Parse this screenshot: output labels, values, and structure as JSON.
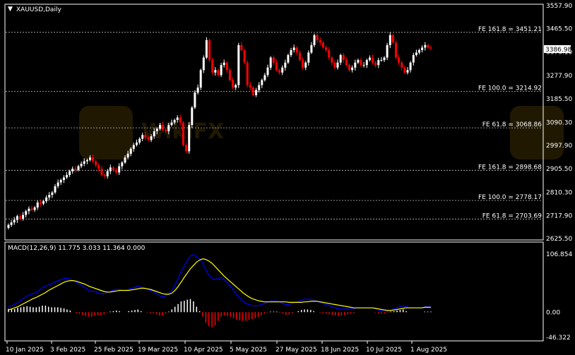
{
  "window": {
    "symbol_label": "XAUUSD,Daily",
    "current_price_label": "3386.98",
    "macd_label": "MACD(12,26,9) 11.775 3.033 11.364 0.000"
  },
  "colors": {
    "background": "#000000",
    "frame": "#ffffff",
    "bull_candle": "#ffffff",
    "bear_candle": "#ff0000",
    "fib_lines": "#c0c0c0",
    "macd_line": "#0000ff",
    "signal_line": "#ffff00",
    "hist_positive": "#ffffff",
    "hist_negative": "#ff0000"
  },
  "chart_data": [
    {
      "type": "candlestick",
      "title": "XAUUSD,Daily",
      "ylim": [
        2625.5,
        3557.9
      ],
      "y_ticks": [
        "3557.90",
        "3465.50",
        "3373.10",
        "3277.90",
        "3185.50",
        "3090.30",
        "2997.90",
        "2905.50",
        "2810.30",
        "2717.90",
        "2625.50"
      ],
      "x_ticks": [
        "10 Jan 2025",
        "3 Feb 2025",
        "25 Feb 2025",
        "19 Mar 2025",
        "10 Apr 2025",
        "5 May 2025",
        "27 May 2025",
        "18 Jun 2025",
        "10 Jul 2025",
        "1 Aug 2025"
      ],
      "levels": [
        {
          "label": "FE 161.8 = 3451.21",
          "value": 3451.21
        },
        {
          "label": "FE 100.0 = 3214.92",
          "value": 3214.92
        },
        {
          "label": "FE 61.8 = 3068.86",
          "value": 3068.86
        },
        {
          "label": "FE 161.8 = 2898.68",
          "value": 2898.68
        },
        {
          "label": "FE 100.0 = 2778.17",
          "value": 2778.17
        },
        {
          "label": "FE 61.8 = 2703.69",
          "value": 2703.69
        }
      ],
      "last_price": 3386.98,
      "close_approx": [
        2680,
        2690,
        2700,
        2715,
        2705,
        2720,
        2735,
        2745,
        2740,
        2750,
        2770,
        2765,
        2775,
        2790,
        2800,
        2810,
        2835,
        2850,
        2860,
        2870,
        2880,
        2895,
        2905,
        2900,
        2915,
        2925,
        2935,
        2940,
        2950,
        2935,
        2920,
        2905,
        2880,
        2875,
        2895,
        2910,
        2900,
        2890,
        2915,
        2930,
        2950,
        2965,
        2985,
        3000,
        3010,
        3025,
        3040,
        3030,
        3020,
        3035,
        3055,
        3065,
        3080,
        3060,
        3055,
        3080,
        3090,
        3100,
        3110,
        3090,
        3000,
        2975,
        3080,
        3150,
        3210,
        3230,
        3300,
        3350,
        3420,
        3340,
        3290,
        3300,
        3280,
        3320,
        3330,
        3300,
        3260,
        3230,
        3240,
        3400,
        3380,
        3330,
        3240,
        3230,
        3200,
        3220,
        3240,
        3260,
        3280,
        3310,
        3350,
        3330,
        3300,
        3290,
        3310,
        3330,
        3360,
        3380,
        3390,
        3370,
        3340,
        3310,
        3330,
        3370,
        3400,
        3440,
        3420,
        3410,
        3390,
        3380,
        3350,
        3330,
        3310,
        3330,
        3360,
        3340,
        3320,
        3300,
        3310,
        3330,
        3340,
        3320,
        3320,
        3340,
        3350,
        3330,
        3320,
        3340,
        3340,
        3350,
        3400,
        3440,
        3410,
        3350,
        3330,
        3310,
        3290,
        3300,
        3330,
        3360,
        3370,
        3380,
        3390,
        3400,
        3390,
        3386.98
      ]
    },
    {
      "type": "line",
      "title": "MACD(12,26,9) 11.775 3.033 11.364 0.000",
      "ylim": [
        -46.322,
        106.854
      ],
      "y_ticks": [
        "106.854",
        "0.00",
        "-46.322"
      ],
      "series": [
        {
          "name": "MACD",
          "values": [
            10,
            12,
            14,
            18,
            22,
            26,
            30,
            32,
            34,
            36,
            40,
            45,
            48,
            50,
            52,
            55,
            58,
            60,
            62,
            62,
            61,
            58,
            55,
            52,
            48,
            44,
            40,
            38,
            38,
            36,
            34,
            34,
            36,
            38,
            40,
            42,
            42,
            40,
            40,
            42,
            44,
            46,
            48,
            46,
            44,
            42,
            40,
            38,
            34,
            30,
            28,
            30,
            34,
            40,
            50,
            62,
            75,
            85,
            95,
            104,
            106,
            102,
            98,
            90,
            78,
            68,
            62,
            60,
            62,
            64,
            60,
            54,
            48,
            40,
            32,
            26,
            20,
            16,
            14,
            12,
            12,
            12,
            14,
            16,
            18,
            20,
            20,
            20,
            18,
            16,
            14,
            14,
            16,
            18,
            20,
            22,
            24,
            24,
            24,
            22,
            20,
            18,
            16,
            14,
            12,
            10,
            8,
            6,
            6,
            6,
            6,
            6,
            6,
            8,
            8,
            8,
            8,
            8,
            8,
            6,
            4,
            2,
            2,
            2,
            4,
            6,
            8,
            10,
            12,
            10,
            8,
            8,
            8,
            8,
            8,
            10,
            10,
            10
          ]
        },
        {
          "name": "Signal",
          "values": [
            4,
            6,
            8,
            10,
            13,
            16,
            19,
            22,
            25,
            27,
            30,
            33,
            36,
            40,
            43,
            46,
            49,
            52,
            55,
            57,
            58,
            58,
            57,
            55,
            53,
            51,
            48,
            46,
            44,
            42,
            40,
            38,
            37,
            37,
            38,
            39,
            40,
            40,
            40,
            40,
            41,
            42,
            43,
            44,
            44,
            43,
            42,
            40,
            38,
            36,
            34,
            33,
            33,
            35,
            40,
            47,
            55,
            64,
            72,
            80,
            86,
            92,
            96,
            98,
            97,
            94,
            90,
            84,
            78,
            72,
            66,
            61,
            56,
            51,
            46,
            41,
            36,
            32,
            28,
            25,
            23,
            21,
            20,
            19,
            19,
            19,
            19,
            19,
            19,
            19,
            19,
            18,
            18,
            18,
            18,
            18,
            19,
            19,
            20,
            20,
            20,
            19,
            18,
            17,
            16,
            15,
            14,
            13,
            12,
            11,
            10,
            9,
            8,
            8,
            8,
            8,
            8,
            8,
            8,
            7,
            6,
            5,
            4,
            3,
            3,
            4,
            5,
            6,
            7,
            8,
            8,
            8,
            8,
            8,
            8,
            9,
            9,
            9
          ]
        }
      ]
    }
  ]
}
